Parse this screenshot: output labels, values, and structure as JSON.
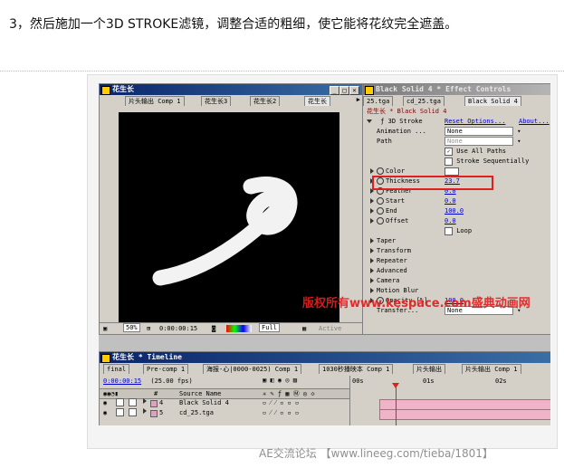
{
  "caption": "3，然后施加一个3D STROKE滤镜，调整合适的粗细，使它能将花纹完全遮盖。",
  "comp_window": {
    "title": "花生长",
    "tabs": [
      "片头输出 Comp 1",
      "花生长3",
      "花生长2",
      "花生长"
    ],
    "footer": {
      "zoom": "50%",
      "timecode": "0:00:00:15",
      "quality": "Full",
      "active_label": "Active"
    }
  },
  "effect_window": {
    "title": "Black Solid 4 * Effect Controls",
    "tabs": [
      "25.tga",
      "cd_25.tga",
      "Black Solid 4"
    ],
    "subheader": "花生长 * Black Solid 4",
    "effect_name": "3D Stroke",
    "reset_label": "Reset Options...",
    "about_label": "About...",
    "props": [
      {
        "label": "Animation ...",
        "value": "None",
        "kind": "dropdown"
      },
      {
        "label": "Path",
        "value": "None",
        "kind": "dropdown-disabled"
      },
      {
        "label": "",
        "value": "Use All Paths",
        "kind": "checkbox",
        "checked": true
      },
      {
        "label": "",
        "value": "Stroke Sequentially",
        "kind": "checkbox",
        "checked": false
      },
      {
        "label": "Color",
        "value": "",
        "kind": "color"
      },
      {
        "label": "Thickness",
        "value": "23.7",
        "kind": "number",
        "highlight": true
      },
      {
        "label": "Feather",
        "value": "0.0",
        "kind": "number"
      },
      {
        "label": "Start",
        "value": "0.0",
        "kind": "number"
      },
      {
        "label": "End",
        "value": "100.0",
        "kind": "number"
      },
      {
        "label": "Offset",
        "value": "0.0",
        "kind": "number"
      },
      {
        "label": "",
        "value": "Loop",
        "kind": "checkbox",
        "checked": false
      },
      {
        "label": "Taper",
        "value": "",
        "kind": "group"
      },
      {
        "label": "Transform",
        "value": "",
        "kind": "group"
      },
      {
        "label": "Repeater",
        "value": "",
        "kind": "group"
      },
      {
        "label": "Advanced",
        "value": "",
        "kind": "group"
      },
      {
        "label": "Camera",
        "value": "",
        "kind": "group"
      },
      {
        "label": "Motion Blur",
        "value": "",
        "kind": "group"
      },
      {
        "label": "Opacity [%]",
        "value": "100.0",
        "kind": "number"
      },
      {
        "label": "Transfer...",
        "value": "None",
        "kind": "dropdown"
      }
    ],
    "accent": "#e02020"
  },
  "timeline": {
    "title": "花生长 * Timeline",
    "tabs": [
      "final",
      "Pre-comp 1",
      "海报-心|0000-0025) Comp 1",
      "1030秒播映本 Comp 1",
      "片头输出",
      "片头输出 Comp 1"
    ],
    "timecode": "0:00:00:15",
    "fps": "(25.00 fps)",
    "columns": [
      "#",
      "Source Name"
    ],
    "layers": [
      {
        "num": "4",
        "name": "Black Solid 4"
      },
      {
        "num": "5",
        "name": "cd_25.tga"
      }
    ],
    "ruler": [
      "00s",
      "01s",
      "02s"
    ]
  },
  "watermark": "版权所有www.kespace.com盛典动画网",
  "footer_watermark": "AE交流论坛 【www.lineeg.com/tieba/1801】"
}
